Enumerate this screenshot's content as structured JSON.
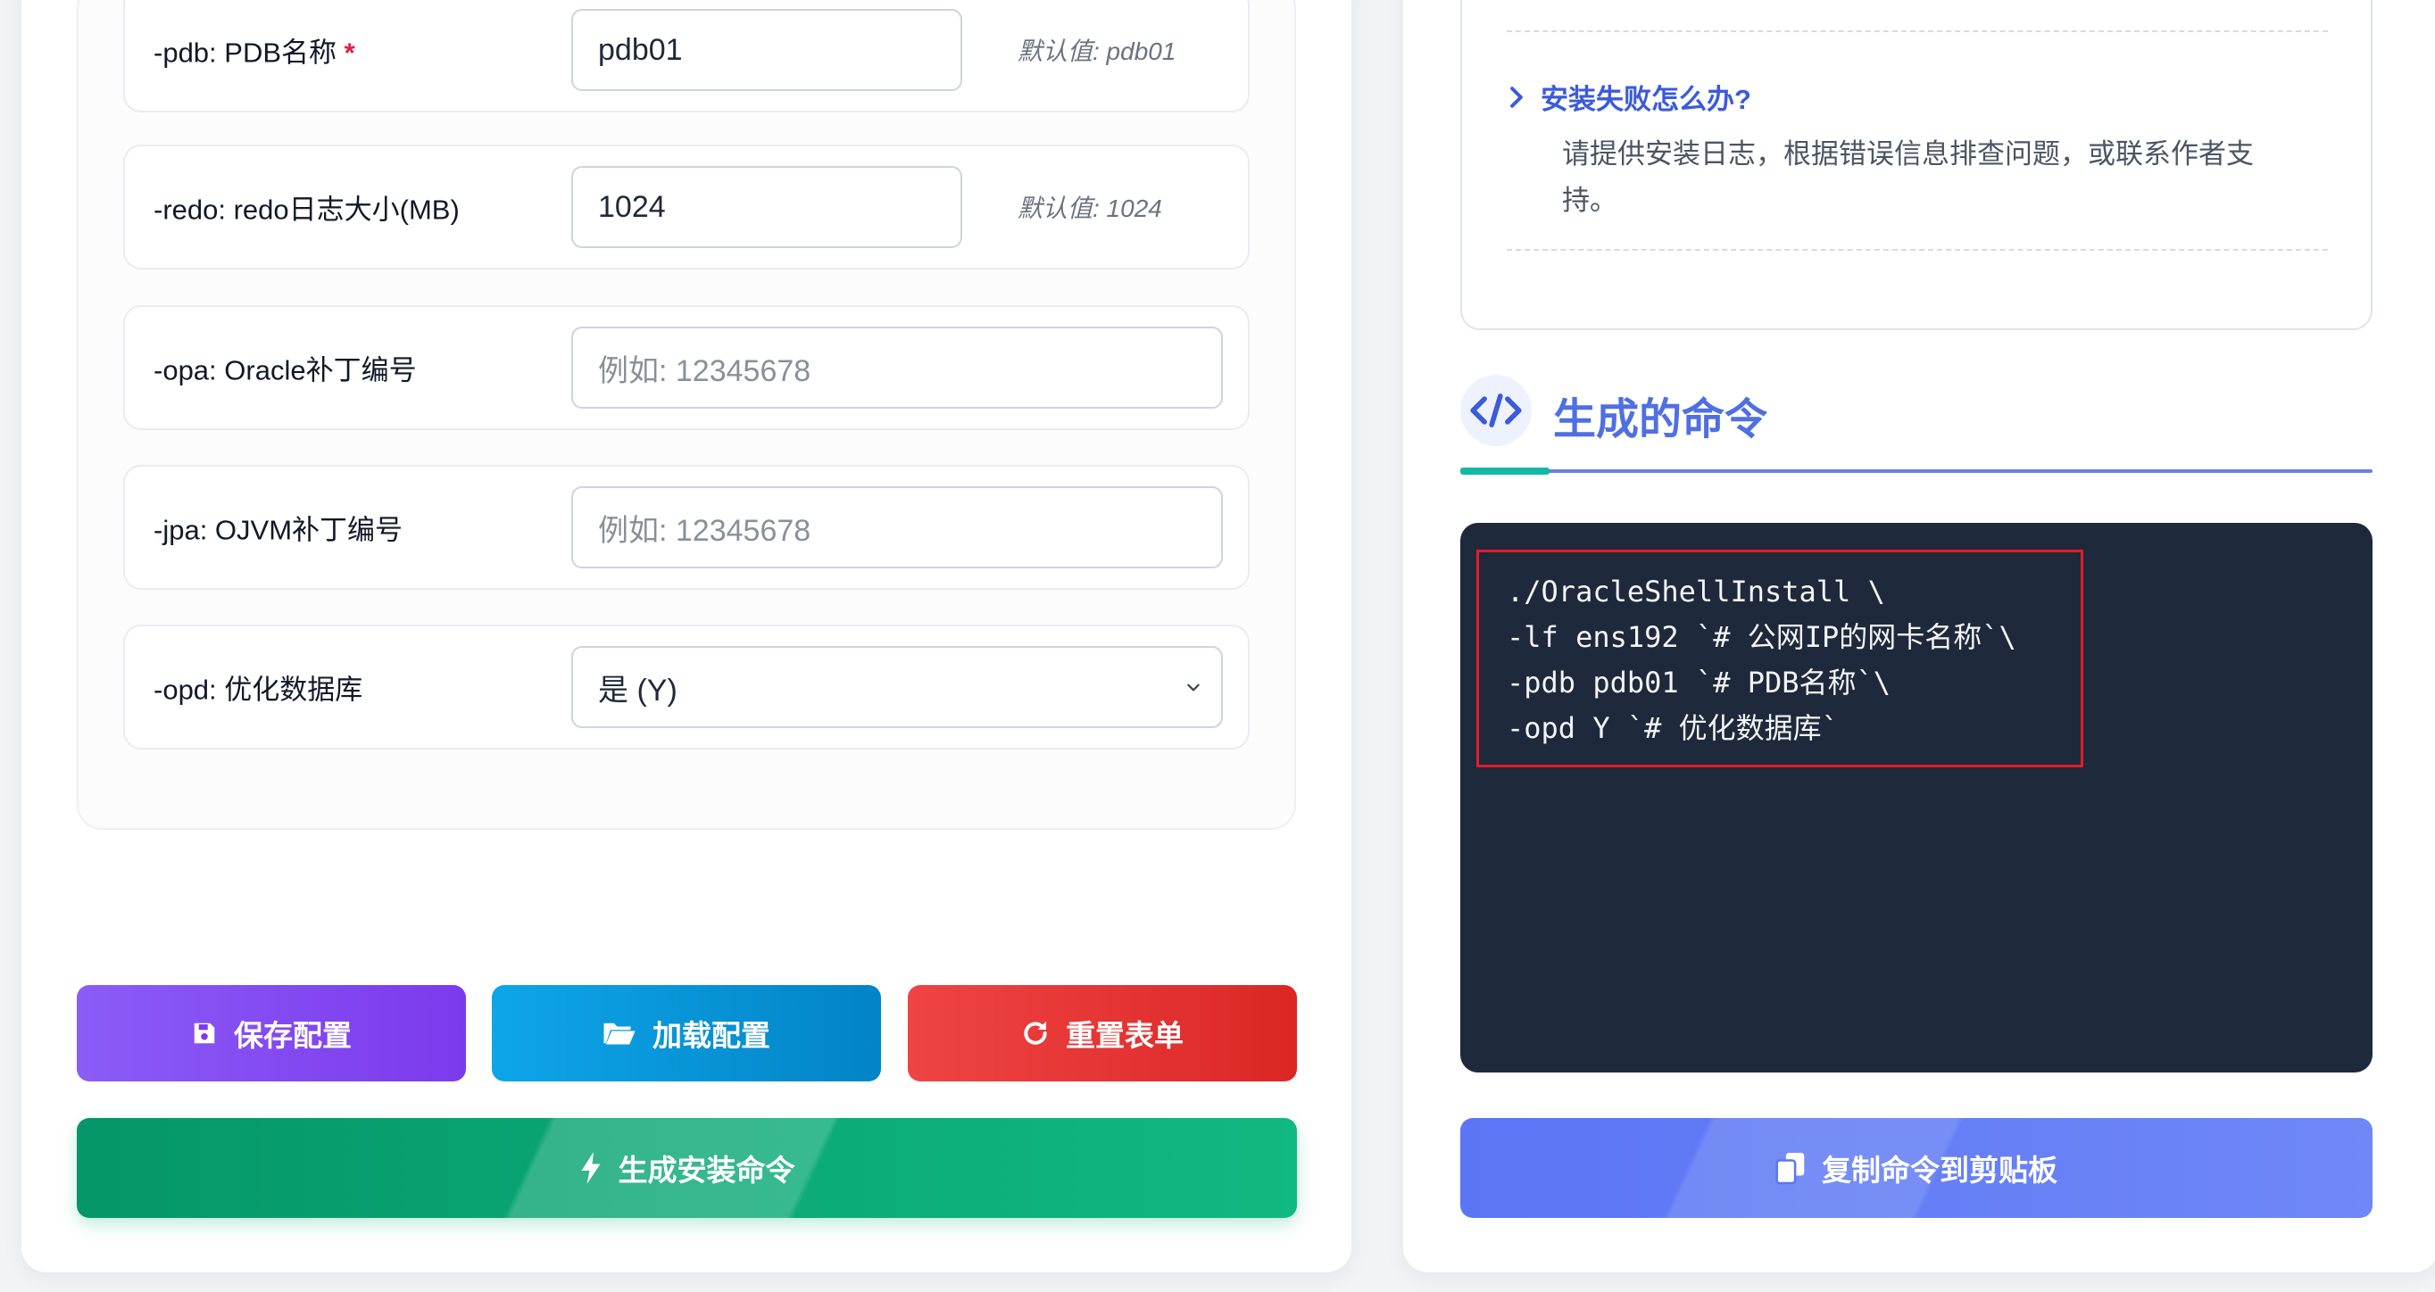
{
  "form": {
    "rows": [
      {
        "label": "-pdb: PDB名称",
        "required": true,
        "value": "pdb01",
        "default": "默认值: pdb01"
      },
      {
        "label": "-redo: redo日志大小(MB)",
        "value": "1024",
        "default": "默认值: 1024"
      },
      {
        "label": "-opa: Oracle补丁编号",
        "placeholder": "例如: 12345678"
      },
      {
        "label": "-jpa: OJVM补丁编号",
        "placeholder": "例如: 12345678"
      },
      {
        "label": "-opd: 优化数据库",
        "selected": "是 (Y)"
      }
    ],
    "required_mark": "*"
  },
  "buttons": {
    "save": "保存配置",
    "load": "加载配置",
    "reset": "重置表单",
    "generate": "生成安装命令",
    "copy": "复制命令到剪贴板"
  },
  "faq": {
    "question": "安装失败怎么办?",
    "answer": "请提供安装日志，根据错误信息排查问题，或联系作者支持。"
  },
  "command_section": {
    "title": "生成的命令",
    "lines": [
      "./OracleShellInstall \\",
      "-lf ens192 `# 公网IP的网卡名称`\\",
      "-pdb pdb01 `# PDB名称`\\",
      "-opd Y `# 优化数据库`"
    ]
  },
  "colors": {
    "accent": "#4f6fe3",
    "save": "#7c3aed",
    "load": "#0284c7",
    "reset": "#dc2626",
    "generate": "#10b981",
    "copy": "#5b76f5",
    "code_bg": "#1e293b",
    "highlight": "#e11d2a"
  },
  "icons": {
    "save": "floppy-disk-icon",
    "load": "folder-open-icon",
    "reset": "rotate-icon",
    "generate": "bolt-icon",
    "copy": "copy-icon",
    "faq": "chevron-right-icon",
    "section": "code-icon",
    "select": "chevron-down-icon"
  }
}
